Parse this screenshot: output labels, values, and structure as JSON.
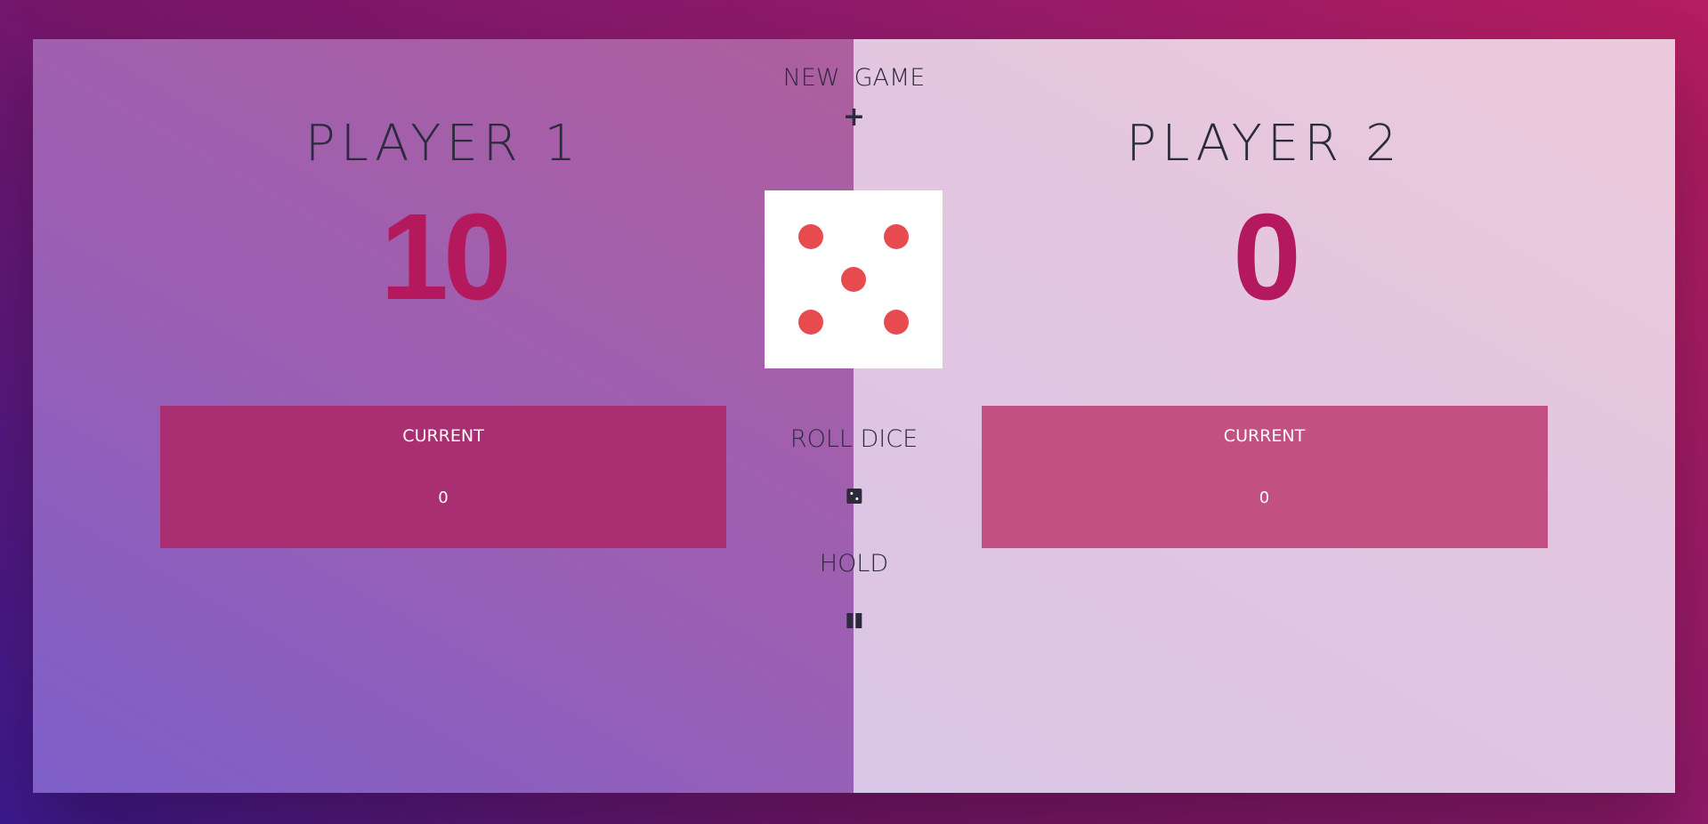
{
  "players": [
    {
      "name": "PLAYER 1",
      "score": "10",
      "current_label": "CURRENT",
      "current_score": "0",
      "active": true
    },
    {
      "name": "PLAYER 2",
      "score": "0",
      "current_label": "CURRENT",
      "current_score": "0",
      "active": false
    }
  ],
  "controls": {
    "new_game_word1": "NEW",
    "new_game_word2": "GAME",
    "new_game_icon": "plus-icon",
    "roll_label": "ROLL DICE",
    "roll_icon": "dice-icon",
    "hold_label": "HOLD",
    "hold_icon": "pause-icon"
  },
  "dice": {
    "value": 5,
    "pip_color": "#e84b4f"
  },
  "colors": {
    "score": "#b5195d",
    "text": "#2b2b3b",
    "current_active": "#a92e72",
    "current_inactive": "#c35083"
  }
}
